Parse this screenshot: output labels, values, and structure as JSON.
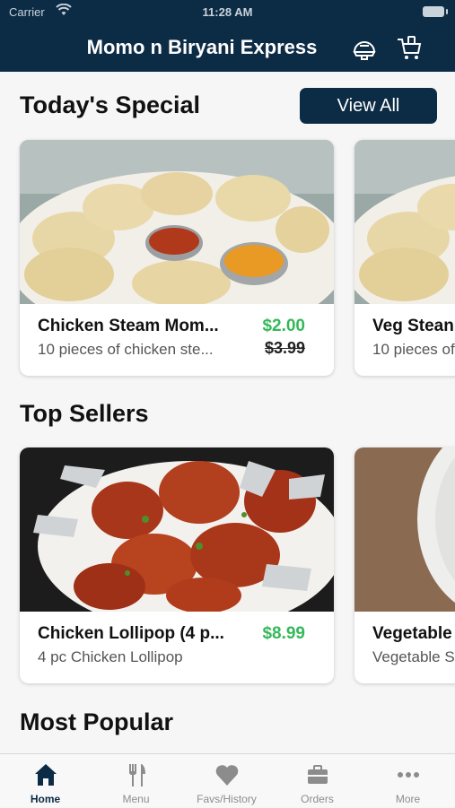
{
  "status_bar": {
    "carrier": "Carrier",
    "time": "11:28 AM"
  },
  "header": {
    "title": "Momo n Biryani Express"
  },
  "sections": {
    "todays_special": {
      "title": "Today's Special",
      "view_all_label": "View All",
      "items": [
        {
          "name": "Chicken Steam Mom...",
          "description": "10 pieces of chicken ste...",
          "price": "$2.00",
          "original_price": "$3.99"
        },
        {
          "name": "Veg Stean",
          "description": "10 pieces of"
        }
      ]
    },
    "top_sellers": {
      "title": "Top Sellers",
      "items": [
        {
          "name": "Chicken Lollipop (4 p...",
          "description": "4 pc Chicken Lollipop",
          "price": "$8.99"
        },
        {
          "name": "Vegetable",
          "description": "Vegetable S"
        }
      ]
    },
    "most_popular": {
      "title": "Most Popular"
    }
  },
  "tabs": [
    {
      "label": "Home",
      "icon": "home-icon",
      "active": true
    },
    {
      "label": "Menu",
      "icon": "fork-knife-icon"
    },
    {
      "label": "Favs/History",
      "icon": "heart-icon"
    },
    {
      "label": "Orders",
      "icon": "briefcase-icon"
    },
    {
      "label": "More",
      "icon": "more-dots-icon"
    }
  ],
  "colors": {
    "primary": "#0c2b45",
    "price_green": "#35b85a",
    "inactive_tab": "#8c8c8c"
  }
}
